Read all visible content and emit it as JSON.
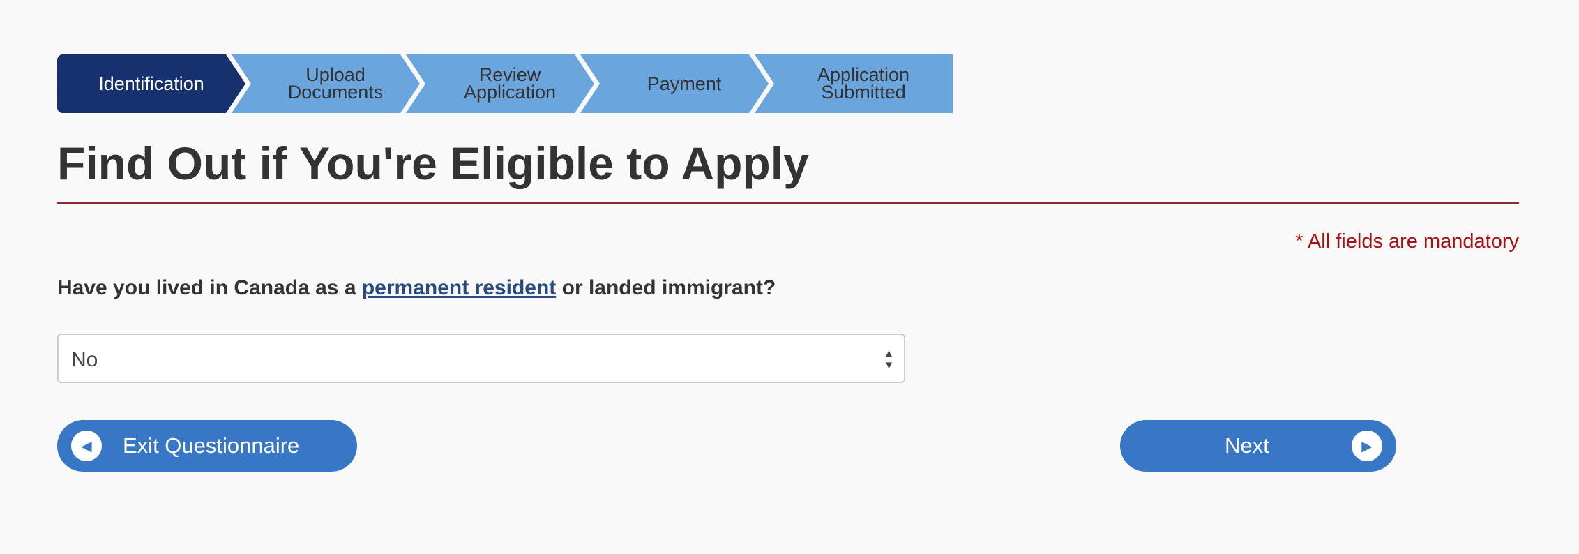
{
  "stepper": {
    "steps": [
      {
        "line1": "Identification",
        "line2": "",
        "active": true
      },
      {
        "line1": "Upload",
        "line2": "Documents",
        "active": false
      },
      {
        "line1": "Review",
        "line2": "Application",
        "active": false
      },
      {
        "line1": "Payment",
        "line2": "",
        "active": false
      },
      {
        "line1": "Application",
        "line2": "Submitted",
        "active": false
      }
    ],
    "active_color": "#17306e",
    "inactive_color": "#6aa5de"
  },
  "page": {
    "title": "Find Out if You're Eligible to Apply",
    "mandatory_note": "* All fields are mandatory"
  },
  "question": {
    "prefix": "Have you lived in Canada as a ",
    "link": "permanent resident",
    "suffix": " or landed immigrant?",
    "selected": "No"
  },
  "buttons": {
    "exit": "Exit Questionnaire",
    "next": "Next"
  }
}
